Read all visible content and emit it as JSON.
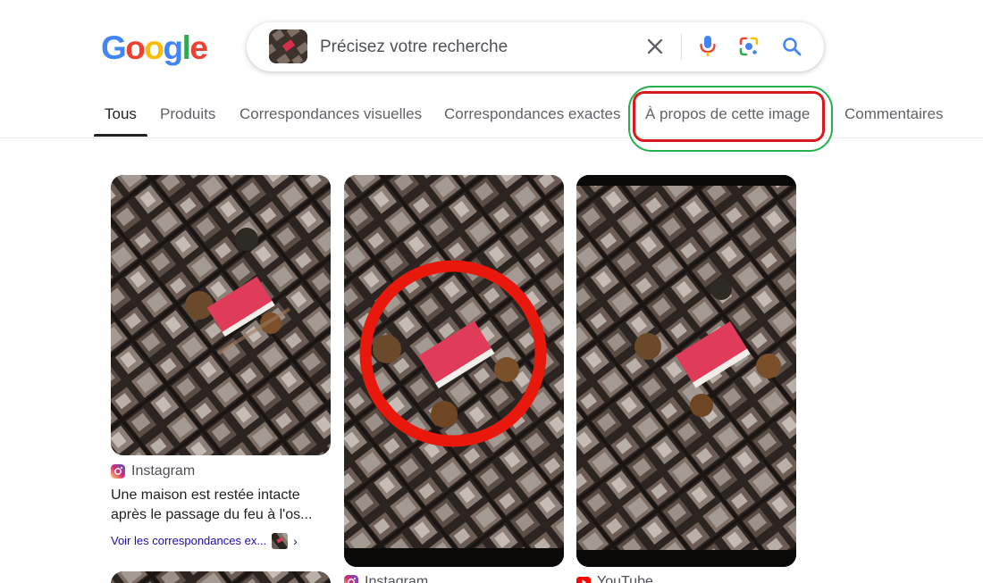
{
  "logo": {
    "text": "Google",
    "letters": [
      "G",
      "o",
      "o",
      "g",
      "l",
      "e"
    ],
    "colors": [
      "#4285F4",
      "#EA4335",
      "#FBBC05",
      "#4285F4",
      "#34A853",
      "#EA4335"
    ]
  },
  "search": {
    "query": "Précisez votre recherche",
    "icons": [
      "image-thumbnail",
      "close-icon",
      "microphone-icon",
      "google-lens-icon",
      "search-icon"
    ]
  },
  "tabs": [
    {
      "label": "Tous",
      "active": true
    },
    {
      "label": "Produits"
    },
    {
      "label": "Correspondances visuelles"
    },
    {
      "label": "Correspondances exactes"
    },
    {
      "label": "À propos de cette image",
      "highlighted": true
    },
    {
      "label": "Commentaires"
    }
  ],
  "annotation_colors": {
    "outer": "#22b14c",
    "inner": "#d9191c"
  },
  "results": [
    {
      "source": "Instagram",
      "title_line1": "Une maison est restée intacte",
      "title_line2": "après le passage du feu à l'os...",
      "exact_link": "Voir les correspondances ex...",
      "chevron": "›"
    },
    {
      "source": "Instagram",
      "marked": true,
      "marker_color": "#e8180d"
    },
    {
      "source": "YouTube"
    }
  ]
}
